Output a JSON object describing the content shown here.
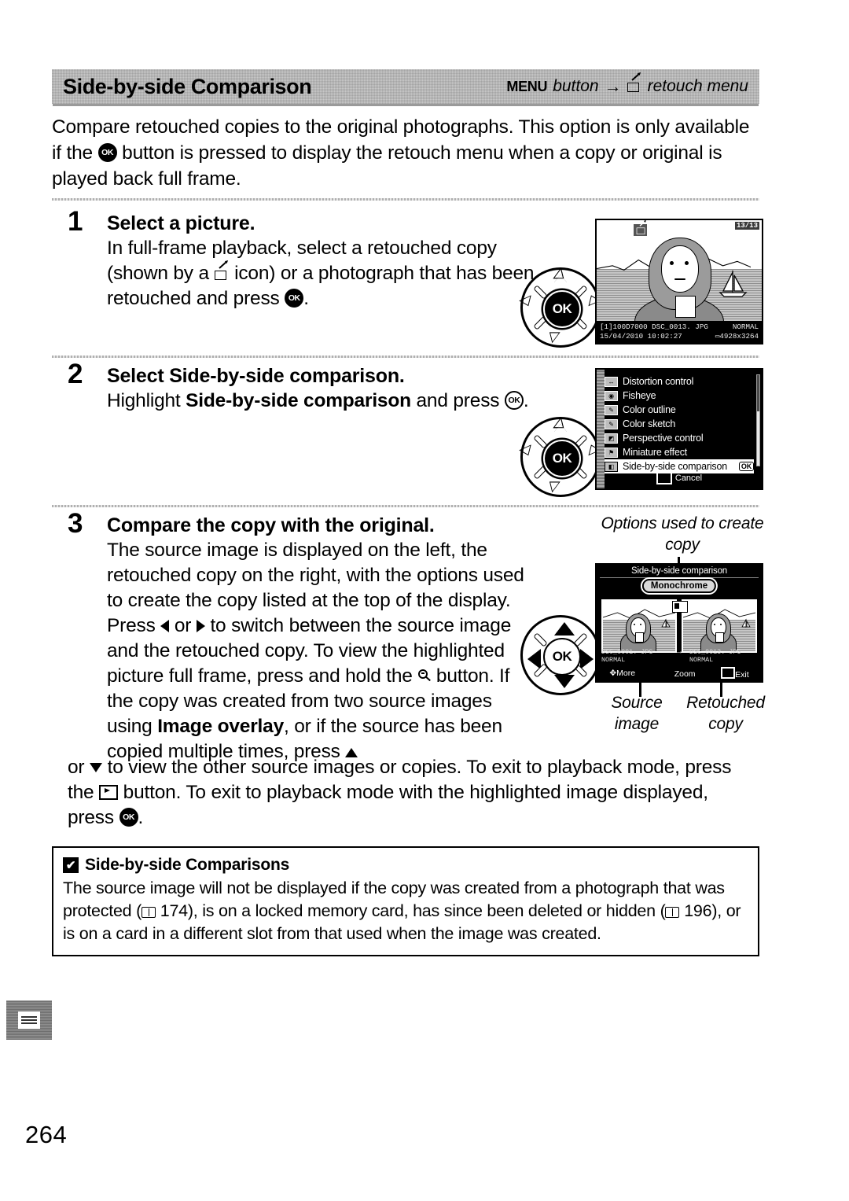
{
  "header": {
    "title": "Side-by-side Comparison",
    "menu_word": "MENU",
    "button_word": "button",
    "arrow": "→",
    "retouch_menu": "retouch menu",
    "retouch_icon": "retouch-pen-icon"
  },
  "intro": {
    "line1": "Compare retouched copies to the original photographs.  This option is only available",
    "line2_a": "if the ",
    "line2_b": " button is pressed to display the retouch menu when a copy or original is",
    "line3": "played back full frame."
  },
  "steps": [
    {
      "number": "1",
      "heading": "Select a picture.",
      "body_a": "In full-frame playback, select a retouched copy (shown by a ",
      "body_b": " icon) or a photograph that has been retouched and press ",
      "body_c": "."
    },
    {
      "number": "2",
      "heading_a": "Select ",
      "heading_b": "Side-by-side comparison",
      "heading_c": ".",
      "body_a": "Highlight ",
      "body_b": "Side-by-side comparison",
      "body_c": " and press ",
      "body_d": "."
    },
    {
      "number": "3",
      "heading": "Compare the copy with the original.",
      "body_1": "The source image is displayed on the left, the retouched copy on the right, with the options used to create the copy listed at the top of the display.  Press ",
      "body_2": " or ",
      "body_3": " to switch between the source image and the retouched copy.  To view the highlighted picture full frame, press and hold the ",
      "body_4": " button.  If the copy was created from two source images using ",
      "body_5": "Image overlay",
      "body_6": ", or if the source has been copied multiple times, press ",
      "body_7": " or ",
      "body_8": " to view the other source images or copies.  To exit to playback mode, press the ",
      "body_9": " button. To exit to playback mode with the highlighted image displayed, press ",
      "body_10": "."
    }
  ],
  "screen_playback": {
    "frame_counter": "13/13",
    "retouch_badge_icon": "retouch-pen-icon",
    "folder": "100D7000",
    "filename": "DSC_0013. JPG",
    "quality": "NORMAL",
    "date": "15/04/2010",
    "time": "10:02:27",
    "size": "4928x3264",
    "slot_icon": "card-slot-icon",
    "size_icon": "image-size-icon"
  },
  "screen_retouch_menu": {
    "items": [
      {
        "label": "Distortion control",
        "icon": "distortion-control-icon",
        "glyph": "↔",
        "selected": false
      },
      {
        "label": "Fisheye",
        "icon": "fisheye-icon",
        "glyph": "◉",
        "selected": false
      },
      {
        "label": "Color outline",
        "icon": "color-outline-icon",
        "glyph": "✎",
        "selected": false
      },
      {
        "label": "Color sketch",
        "icon": "color-sketch-icon",
        "glyph": "✎",
        "selected": false
      },
      {
        "label": "Perspective control",
        "icon": "perspective-control-icon",
        "glyph": "◢",
        "selected": false
      },
      {
        "label": "Miniature effect",
        "icon": "miniature-effect-icon",
        "glyph": "⚑",
        "selected": false
      },
      {
        "label": "Side-by-side comparison",
        "icon": "side-by-side-icon",
        "glyph": "■",
        "selected": true
      }
    ],
    "ok_badge": "OK",
    "cancel_label": "Cancel",
    "cancel_icon": "playback-button-icon",
    "help_icon": "help-icon"
  },
  "screen_side_by_side": {
    "title": "Side-by-side comparison",
    "option_label": "Monochrome",
    "left": {
      "filename": "DSC_0001. JPG",
      "quality": "NORMAL"
    },
    "right": {
      "filename": "DSC_0013. JPG",
      "quality": "NORMAL"
    },
    "arrow": "→",
    "footer": [
      {
        "label": "More",
        "icon": "multi-selector-icon"
      },
      {
        "label": "Zoom",
        "icon": "zoom-in-icon"
      },
      {
        "label": "Exit",
        "icon": "playback-button-icon"
      }
    ],
    "callouts": {
      "top": "Options used to create copy",
      "bottom_left": "Source image",
      "bottom_right": "Retouched copy"
    }
  },
  "caution": {
    "title": "Side-by-side Comparisons",
    "title_icon": "caution-check-icon",
    "text_1": "The source image will not be displayed if the copy was created from a photograph that was protected (",
    "ref_1": "174",
    "text_2": "), is on a locked memory card, has since been deleted or hidden (",
    "ref_2": "196",
    "text_3": "), or is on a card in a different slot from that used when the image was created."
  },
  "footer": {
    "page_number": "264",
    "tab_icon": "menu-tab-icon"
  },
  "dial": {
    "ok_label": "OK"
  }
}
